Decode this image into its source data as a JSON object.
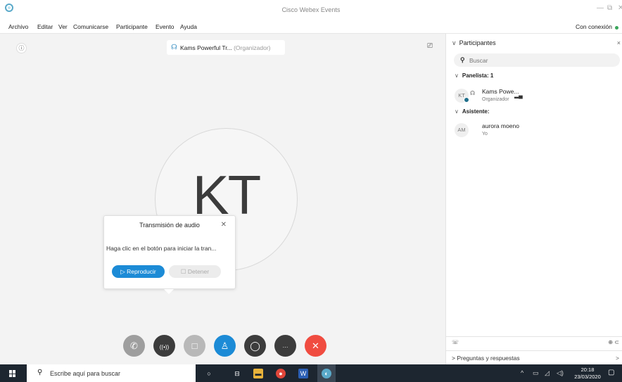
{
  "window": {
    "title": "Cisco Webex Events"
  },
  "menu": {
    "items": [
      "Archivo",
      "Editar",
      "Ver",
      "Comunicarse",
      "Participante",
      "Evento",
      "Ayuda"
    ],
    "connection_status": "Con conexión",
    "connection_color": "#3aa65b"
  },
  "stage": {
    "presenter_name": "Kams Powerful Tr...",
    "presenter_role": "(Organizador)",
    "avatar_initials": "KT"
  },
  "audio_popup": {
    "title": "Transmisión de audio",
    "message": "Haga clic en el botón para iniciar la tran...",
    "play_label": "▷ Reproducir",
    "stop_label": "☐ Detener"
  },
  "controls": [
    {
      "name": "audio-button",
      "icon": "phone-icon",
      "glyph": "✆",
      "color": "#9e9e9e"
    },
    {
      "name": "audio-broadcast-button",
      "icon": "broadcast-icon",
      "glyph": "((•))",
      "color": "#3c3c3c"
    },
    {
      "name": "share-button",
      "icon": "share-icon",
      "glyph": "□",
      "color": "#b8b8b8"
    },
    {
      "name": "participants-button",
      "icon": "participants-icon",
      "glyph": "♙",
      "color": "#1c8bd6"
    },
    {
      "name": "chat-button",
      "icon": "chat-icon",
      "glyph": "◯",
      "color": "#3c3c3c"
    },
    {
      "name": "more-button",
      "icon": "more-icon",
      "glyph": "···",
      "color": "#3c3c3c"
    },
    {
      "name": "leave-button",
      "icon": "close-icon",
      "glyph": "✕",
      "color": "#f04c40"
    }
  ],
  "panel": {
    "title": "Participantes",
    "search_placeholder": "Buscar",
    "panelist_header": "Panelista: 1",
    "attendee_header": "Asistente:",
    "panelists": [
      {
        "initials": "KT",
        "name": "Kams Powe...",
        "role": "Organizador"
      }
    ],
    "attendees": [
      {
        "initials": "AM",
        "name": "aurora moeno",
        "role": "Yo"
      }
    ],
    "qa_label": "Preguntas y respuestas"
  },
  "taskbar": {
    "search_text": "Escribe aquí para buscar",
    "time": "20:18",
    "date": "23/03/2020"
  }
}
